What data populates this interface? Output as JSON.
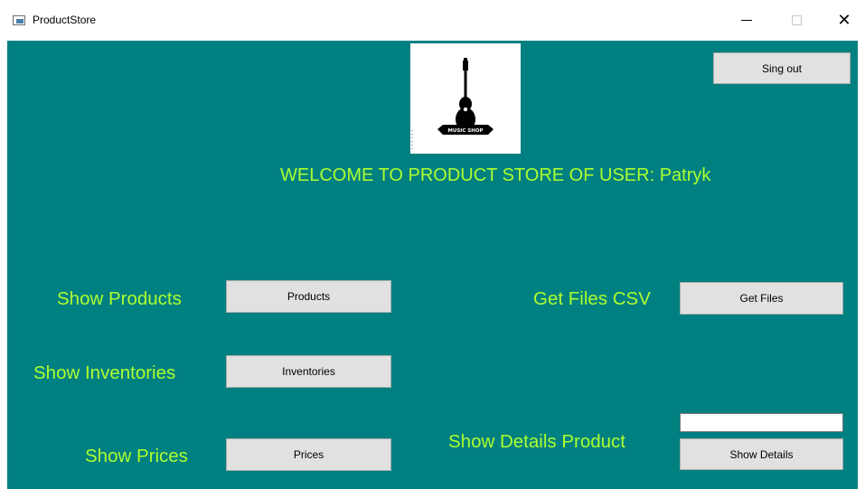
{
  "window": {
    "title": "ProductStore",
    "minimize_icon": "minimize-icon",
    "maximize_icon": "maximize-icon",
    "close_icon": "close-icon",
    "close_glyph": "✕"
  },
  "colors": {
    "background": "#008080",
    "label_text": "#adff2f",
    "button_face": "#e1e1e1"
  },
  "header": {
    "logo_icon": "guitar-logo-icon",
    "logo_text": "MUSIC SHOP",
    "welcome": "WELCOME TO PRODUCT STORE OF USER:  Patryk",
    "sign_out_label": "Sing out"
  },
  "left_actions": {
    "products": {
      "label": "Show Products",
      "button": "Products"
    },
    "inventories": {
      "label": "Show Inventories",
      "button": "Inventories"
    },
    "prices": {
      "label": "Show Prices",
      "button": "Prices"
    }
  },
  "right_actions": {
    "files": {
      "label": "Get Files CSV",
      "button": "Get Files"
    },
    "details": {
      "label": "Show Details Product",
      "button": "Show Details",
      "input_value": "",
      "input_placeholder": ""
    }
  }
}
